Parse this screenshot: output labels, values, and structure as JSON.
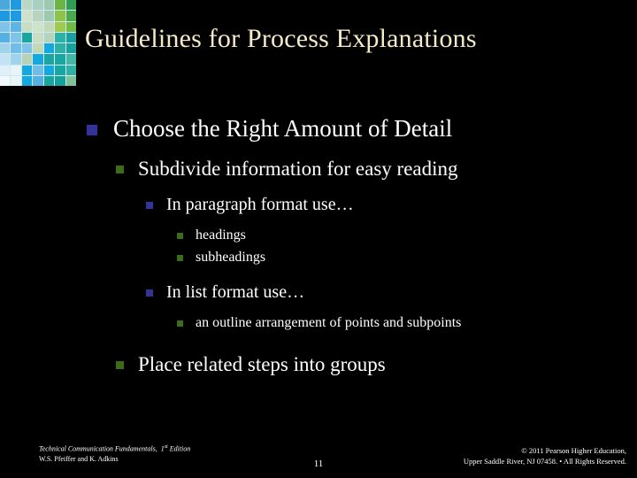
{
  "slide": {
    "title": "Guidelines for Process Explanations",
    "page_number": "11",
    "background_color": "#000000",
    "title_color": "#f7eac8",
    "body_text_color": "#ffffff",
    "bullet_blue": "#333399",
    "bullet_green": "#3e6b16"
  },
  "decoration": {
    "name": "mosaic-grid",
    "columns": 7,
    "rows": 8,
    "cell_colors": [
      [
        "#4aa8dd",
        "#1f9ae0",
        "#b9d7c4",
        "#a8cfbf",
        "#9ec8b0",
        "#6cb544",
        "#2f9e52"
      ],
      [
        "#1f9ae0",
        "#1f9ae0",
        "#cfe1c9",
        "#b8d4c1",
        "#9ec8b0",
        "#8fc24a",
        "#4aa84f"
      ],
      [
        "#7fc3e8",
        "#5fb4e4",
        "#c9dcc4",
        "#cfe3cb",
        "#c2d9b8",
        "#9fc94f",
        "#6fbb45"
      ],
      [
        "#56b0e4",
        "#7fc3e8",
        "#19a6a0",
        "#c9dcc4",
        "#b6d3bb",
        "#2fb0a6",
        "#1a9fa0"
      ],
      [
        "#9fd2ec",
        "#6fbde8",
        "#7fc3e8",
        "#c2d9b8",
        "#14a8e0",
        "#2fb0a6",
        "#17a09c"
      ],
      [
        "#c3e3f4",
        "#9fd2ec",
        "#b9d1b4",
        "#14a8e0",
        "#19a6a0",
        "#19a6a0",
        "#3fb9a6"
      ],
      [
        "#dff0f8",
        "#e8f4fa",
        "#14a8e0",
        "#6fbde8",
        "#14a8e0",
        "#19a6a0",
        "#2fb0a6"
      ],
      [
        "#f2f9fc",
        "#e8f4fa",
        "#14a8e0",
        "#56b0e4",
        "#19a6a0",
        "#17a09c",
        "#7fc39a"
      ]
    ]
  },
  "outline": {
    "level1": {
      "marker": "square-bullet-blue",
      "text": "Choose the Right Amount of Detail"
    },
    "level2_a": {
      "marker": "square-bullet-green",
      "text": "Subdivide information for easy reading"
    },
    "level3_a": {
      "marker": "square-bullet-blue",
      "text": "In paragraph format use…"
    },
    "level4_a": {
      "marker": "square-bullet-green",
      "text": "headings"
    },
    "level4_b": {
      "marker": "square-bullet-green",
      "text": "subheadings"
    },
    "level3_b": {
      "marker": "square-bullet-blue",
      "text": "In list format use…"
    },
    "level4_c": {
      "marker": "square-bullet-green",
      "text": "an outline arrangement of points and subpoints"
    },
    "level2_b": {
      "marker": "square-bullet-green",
      "text": "Place related steps into groups"
    }
  },
  "footer": {
    "book_title": "Technical Communication Fundamentals,",
    "edition_number": "1",
    "edition_suffix": "st",
    "edition_word": "Edition",
    "authors": "W.S. Pfeiffer and K. Adkins",
    "copyright_line1": "© 2011 Pearson Higher Education,",
    "copyright_line2": "Upper Saddle River, NJ 07458. • All Rights Reserved."
  }
}
